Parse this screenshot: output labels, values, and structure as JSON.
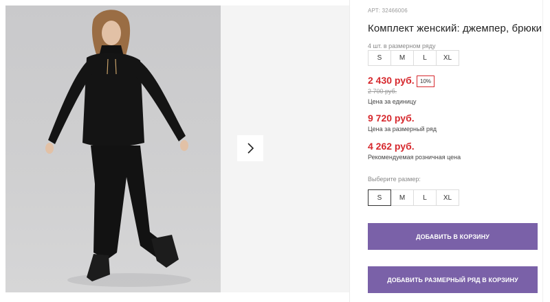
{
  "product": {
    "article": "АРТ: 32466006",
    "title": "Комплект женский: джемпер, брюки"
  },
  "row_sizes": {
    "caption": "4 шт. в размерном ряду",
    "items": [
      "S",
      "M",
      "L",
      "XL"
    ]
  },
  "prices": {
    "unit_price": "2 430 руб.",
    "discount": "10%",
    "old_price": "2 700 руб.",
    "unit_caption": "Цена за единицу",
    "row_price": "9 720 руб.",
    "row_caption": "Цена за размерный ряд",
    "retail_price": "4 262 руб.",
    "retail_caption": "Рекомендуемая розничная цена"
  },
  "size_picker": {
    "caption": "Выберите размер:",
    "items": [
      "S",
      "M",
      "L",
      "XL"
    ],
    "selected": "S"
  },
  "buttons": {
    "add_to_cart": "ДОБАВИТЬ В КОРЗИНУ",
    "add_row_to_cart": "ДОБАВИТЬ РАЗМЕРНЫЙ РЯД В КОРЗИНУ"
  },
  "gallery": {
    "next_icon": "chevron-right-icon"
  },
  "colors": {
    "accent": "#7a61a8",
    "price": "#d6282d"
  }
}
